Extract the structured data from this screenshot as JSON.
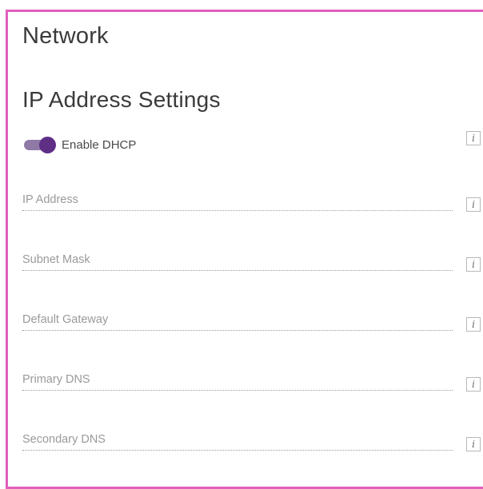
{
  "page": {
    "title": "Network",
    "section_title": "IP Address Settings"
  },
  "dhcp": {
    "label": "Enable DHCP",
    "enabled": true
  },
  "info_icon_glyph": "i",
  "fields": {
    "ip_address": {
      "placeholder": "IP Address",
      "value": ""
    },
    "subnet_mask": {
      "placeholder": "Subnet Mask",
      "value": ""
    },
    "default_gateway": {
      "placeholder": "Default Gateway",
      "value": ""
    },
    "primary_dns": {
      "placeholder": "Primary DNS",
      "value": ""
    },
    "secondary_dns": {
      "placeholder": "Secondary DNS",
      "value": ""
    }
  },
  "colors": {
    "frame_border": "#e05fbd",
    "toggle_thumb": "#5f2f86",
    "toggle_track": "#8f7aa6"
  }
}
